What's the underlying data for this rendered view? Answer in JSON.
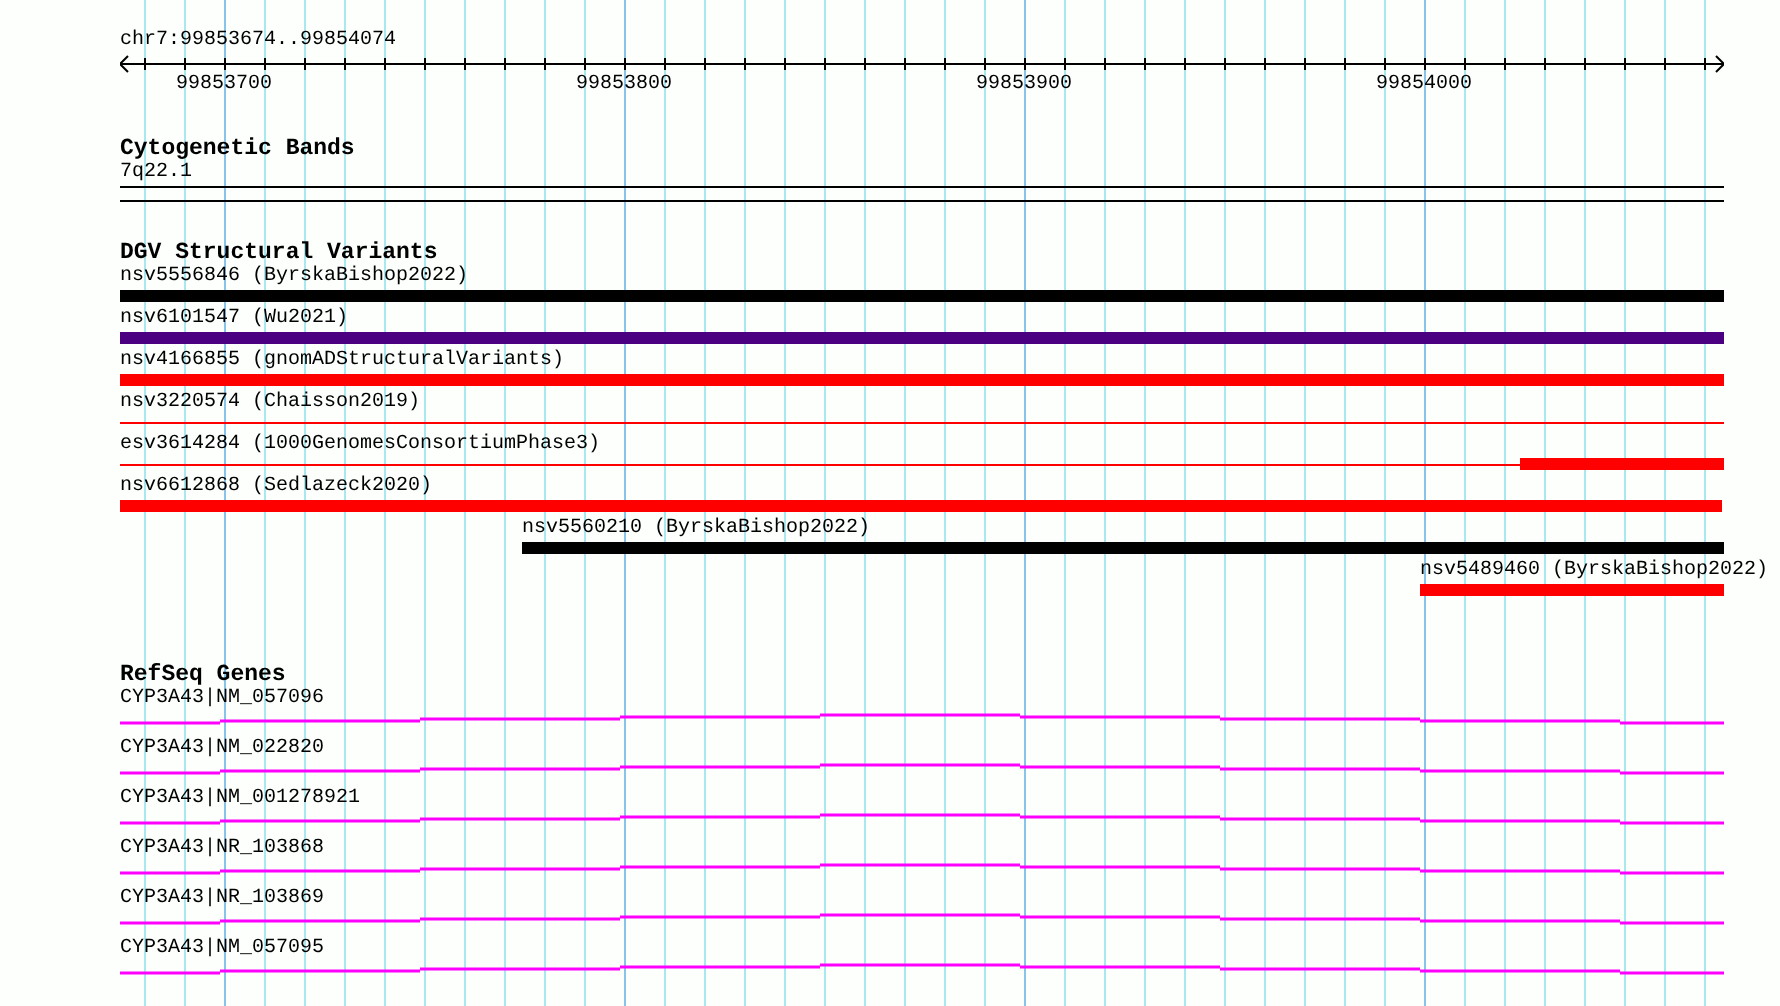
{
  "ruler": {
    "location": "chr7:99853674..99854074",
    "tick_labels": [
      "99853700",
      "99853800",
      "99853900",
      "99854000"
    ]
  },
  "cytoband_track": {
    "title": "Cytogenetic Bands",
    "band": "7q22.1"
  },
  "variant_track": {
    "title": "DGV Structural Variants",
    "variants": [
      {
        "label": "nsv5556846 (ByrskaBishop2022)",
        "kind": "thick",
        "color": "#000000"
      },
      {
        "label": "nsv6101547 (Wu2021)",
        "kind": "thick",
        "color": "#4b0082"
      },
      {
        "label": "nsv4166855 (gnomADStructuralVariants)",
        "kind": "thick",
        "color": "#ff0000"
      },
      {
        "label": "nsv3220574 (Chaisson2019)",
        "kind": "thin",
        "color": "#ff0000"
      },
      {
        "label": "esv3614284 (1000GenomesConsortiumPhase3)",
        "kind": "mixed",
        "color": "#ff0000"
      },
      {
        "label": "nsv6612868 (Sedlazeck2020)",
        "kind": "thick",
        "color": "#ff0000"
      },
      {
        "label": "nsv5560210 (ByrskaBishop2022)",
        "kind": "thick",
        "color": "#000000"
      },
      {
        "label": "nsv5489460 (ByrskaBishop2022)",
        "kind": "thick",
        "color": "#ff0000"
      }
    ]
  },
  "gene_track": {
    "title": "RefSeq Genes",
    "genes": [
      {
        "label": "CYP3A43|NM_057096"
      },
      {
        "label": "CYP3A43|NM_022820"
      },
      {
        "label": "CYP3A43|NM_001278921"
      },
      {
        "label": "CYP3A43|NR_103868"
      },
      {
        "label": "CYP3A43|NR_103869"
      },
      {
        "label": "CYP3A43|NM_057095"
      }
    ]
  }
}
